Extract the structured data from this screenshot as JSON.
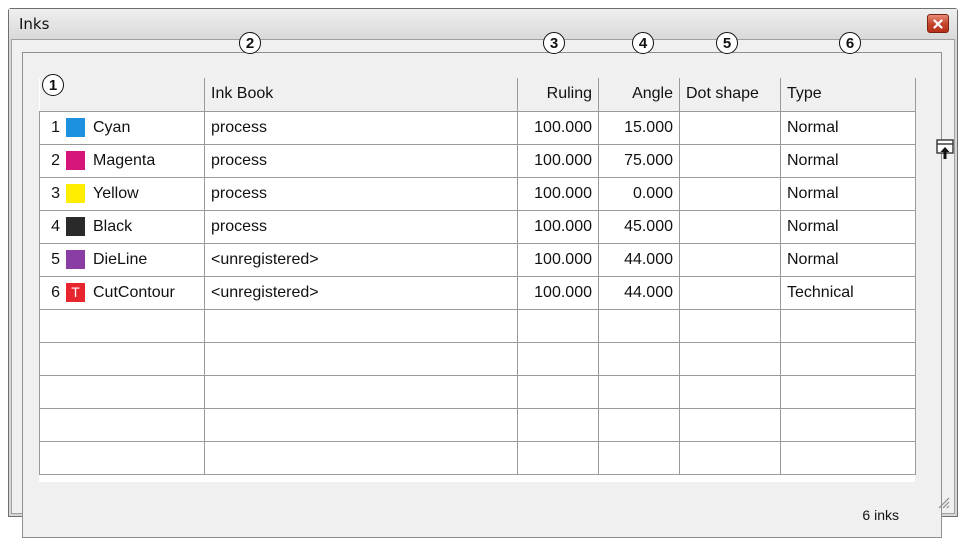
{
  "window": {
    "title": "Inks",
    "close_icon": "close-icon"
  },
  "callouts": [
    "1",
    "2",
    "3",
    "4",
    "5",
    "6"
  ],
  "columns": {
    "ink": "",
    "ink_book": "Ink Book",
    "ruling": "Ruling",
    "angle": "Angle",
    "dot_shape": "Dot shape",
    "type": "Type"
  },
  "inks": [
    {
      "index": "1",
      "name": "Cyan",
      "color": "#1e90e0",
      "glyph": "",
      "ink_book": "process",
      "ruling": "100.000",
      "angle": "15.000",
      "dot_shape": "",
      "type": "Normal"
    },
    {
      "index": "2",
      "name": "Magenta",
      "color": "#d6157a",
      "glyph": "",
      "ink_book": "process",
      "ruling": "100.000",
      "angle": "75.000",
      "dot_shape": "",
      "type": "Normal"
    },
    {
      "index": "3",
      "name": "Yellow",
      "color": "#ffee00",
      "glyph": "",
      "ink_book": "process",
      "ruling": "100.000",
      "angle": "0.000",
      "dot_shape": "",
      "type": "Normal"
    },
    {
      "index": "4",
      "name": "Black",
      "color": "#2a2a2a",
      "glyph": "",
      "ink_book": "process",
      "ruling": "100.000",
      "angle": "45.000",
      "dot_shape": "",
      "type": "Normal"
    },
    {
      "index": "5",
      "name": "DieLine",
      "color": "#8a3da3",
      "glyph": "",
      "ink_book": "<unregistered>",
      "ruling": "100.000",
      "angle": "44.000",
      "dot_shape": "",
      "type": "Normal"
    },
    {
      "index": "6",
      "name": "CutContour",
      "color": "#e8242e",
      "glyph": "T",
      "ink_book": "<unregistered>",
      "ruling": "100.000",
      "angle": "44.000",
      "dot_shape": "",
      "type": "Technical"
    }
  ],
  "empty_rows": 5,
  "side_icon": "pin-up-icon",
  "status": {
    "count_text": "6 inks"
  }
}
